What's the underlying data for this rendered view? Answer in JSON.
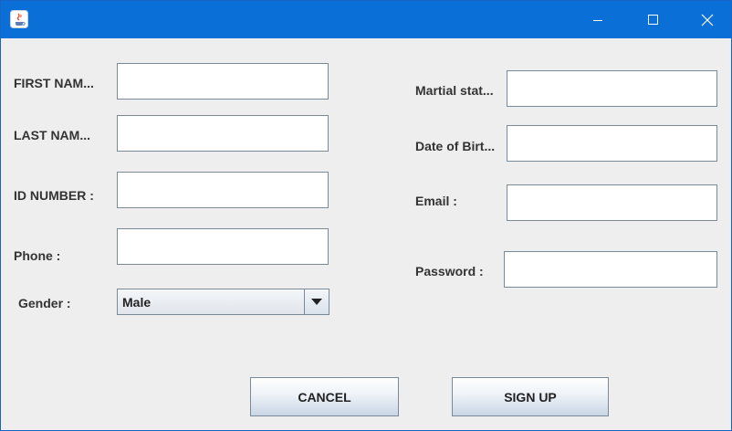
{
  "window": {
    "controls": {
      "minimize_icon": "minimize-icon",
      "maximize_icon": "maximize-icon",
      "close_icon": "close-icon"
    }
  },
  "form": {
    "first_name_label": "FIRST NAM...",
    "last_name_label": "LAST NAM...",
    "id_number_label": "ID NUMBER :",
    "phone_label": "Phone :",
    "gender_label": "Gender :",
    "gender_value": "Male",
    "marital_label": "Martial stat...",
    "dob_label": "Date of Birt...",
    "email_label": "Email :",
    "password_label": "Password :"
  },
  "buttons": {
    "cancel": "CANCEL",
    "signup": "SIGN UP"
  },
  "colors": {
    "titlebar": "#0a6fd6",
    "background": "#eeeeee",
    "field_border": "#7a8a99"
  }
}
